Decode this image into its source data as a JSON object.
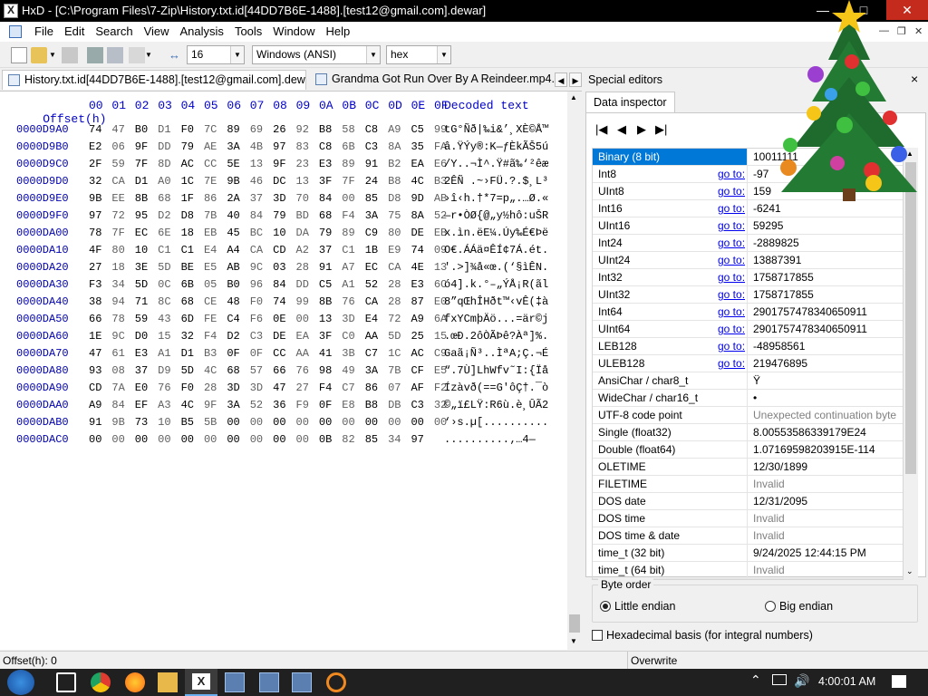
{
  "window": {
    "title": "HxD - [C:\\Program Files\\7-Zip\\History.txt.id[44DD7B6E-1488].[test12@gmail.com].dewar]"
  },
  "menu": [
    "File",
    "Edit",
    "Search",
    "View",
    "Analysis",
    "Tools",
    "Window",
    "Help"
  ],
  "toolbar": {
    "bytes_per_row": "16",
    "charset": "Windows (ANSI)",
    "offset_base": "hex"
  },
  "tabs": [
    {
      "label": "History.txt.id[44DD7B6E-1488].[test12@gmail.com].dewar"
    },
    {
      "label": "Grandma Got Run Over By A Reindeer.mp4.id["
    }
  ],
  "hex": {
    "offset_header": "Offset(h)",
    "column_headers": [
      "00",
      "01",
      "02",
      "03",
      "04",
      "05",
      "06",
      "07",
      "08",
      "09",
      "0A",
      "0B",
      "0C",
      "0D",
      "0E",
      "0F"
    ],
    "decoded_header": "Decoded text",
    "rows": [
      {
        "offset": "0000D9A0",
        "bytes": [
          "74",
          "47",
          "B0",
          "D1",
          "F0",
          "7C",
          "89",
          "69",
          "26",
          "92",
          "B8",
          "58",
          "C8",
          "A9",
          "C5",
          "99"
        ],
        "text": "tG°Ñð|‰i&’¸XÈ©Å™"
      },
      {
        "offset": "0000D9B0",
        "bytes": [
          "E2",
          "06",
          "9F",
          "DD",
          "79",
          "AE",
          "3A",
          "4B",
          "97",
          "83",
          "C8",
          "6B",
          "C3",
          "8A",
          "35",
          "FA"
        ],
        "text": "â.ŸÝy®:K—ƒÈkÃŠ5ú"
      },
      {
        "offset": "0000D9C0",
        "bytes": [
          "2F",
          "59",
          "7F",
          "8D",
          "AC",
          "CC",
          "5E",
          "13",
          "9F",
          "23",
          "E3",
          "89",
          "91",
          "B2",
          "EA",
          "E6"
        ],
        "text": "/Y..¬Ì^.Ÿ#ã‰‘²êæ"
      },
      {
        "offset": "0000D9D0",
        "bytes": [
          "32",
          "CA",
          "D1",
          "A0",
          "1C",
          "7E",
          "9B",
          "46",
          "DC",
          "13",
          "3F",
          "7F",
          "24",
          "B8",
          "4C",
          "B3"
        ],
        "text": "2ÊÑ .~›FÜ.?.$¸L³"
      },
      {
        "offset": "0000D9E0",
        "bytes": [
          "9B",
          "EE",
          "8B",
          "68",
          "1F",
          "86",
          "2A",
          "37",
          "3D",
          "70",
          "84",
          "00",
          "85",
          "D8",
          "9D",
          "AB"
        ],
        "text": "›î‹h.†*7=p„.…Ø.«"
      },
      {
        "offset": "0000D9F0",
        "bytes": [
          "97",
          "72",
          "95",
          "D2",
          "D8",
          "7B",
          "40",
          "84",
          "79",
          "BD",
          "68",
          "F4",
          "3A",
          "75",
          "8A",
          "52"
        ],
        "text": "—r•ÒØ{@„y½hô:uŠR"
      },
      {
        "offset": "0000DA00",
        "bytes": [
          "78",
          "7F",
          "EC",
          "6E",
          "18",
          "EB",
          "45",
          "BC",
          "10",
          "DA",
          "79",
          "89",
          "C9",
          "80",
          "DE",
          "EB"
        ],
        "text": "x.ìn.ëE¼.Úy‰É€Þë"
      },
      {
        "offset": "0000DA10",
        "bytes": [
          "4F",
          "80",
          "10",
          "C1",
          "C1",
          "E4",
          "A4",
          "CA",
          "CD",
          "A2",
          "37",
          "C1",
          "1B",
          "E9",
          "74",
          "09"
        ],
        "text": "O€.ÁÁä¤ÊÍ¢7Á.ét."
      },
      {
        "offset": "0000DA20",
        "bytes": [
          "27",
          "18",
          "3E",
          "5D",
          "BE",
          "E5",
          "AB",
          "9C",
          "03",
          "28",
          "91",
          "A7",
          "EC",
          "CA",
          "4E",
          "13"
        ],
        "text": "'.>]¾å«œ.(‘§ìÊN."
      },
      {
        "offset": "0000DA30",
        "bytes": [
          "F3",
          "34",
          "5D",
          "0C",
          "6B",
          "05",
          "B0",
          "96",
          "84",
          "DD",
          "C5",
          "A1",
          "52",
          "28",
          "E3",
          "6C"
        ],
        "text": "ó4].k.°–„ÝÅ¡R(ãl"
      },
      {
        "offset": "0000DA40",
        "bytes": [
          "38",
          "94",
          "71",
          "8C",
          "68",
          "CE",
          "48",
          "F0",
          "74",
          "99",
          "8B",
          "76",
          "CA",
          "28",
          "87",
          "E0"
        ],
        "text": "8”qŒhÎHðt™‹vÊ(‡à"
      },
      {
        "offset": "0000DA50",
        "bytes": [
          "66",
          "78",
          "59",
          "43",
          "6D",
          "FE",
          "C4",
          "F6",
          "0E",
          "00",
          "13",
          "3D",
          "E4",
          "72",
          "A9",
          "6A"
        ],
        "text": "fxYCmþÄö...=är©j"
      },
      {
        "offset": "0000DA60",
        "bytes": [
          "1E",
          "9C",
          "D0",
          "15",
          "32",
          "F4",
          "D2",
          "C3",
          "DE",
          "EA",
          "3F",
          "C0",
          "AA",
          "5D",
          "25",
          "15"
        ],
        "text": ".œÐ.2ôÒÃÞê?Àª]%."
      },
      {
        "offset": "0000DA70",
        "bytes": [
          "47",
          "61",
          "E3",
          "A1",
          "D1",
          "B3",
          "0F",
          "0F",
          "CC",
          "AA",
          "41",
          "3B",
          "C7",
          "1C",
          "AC",
          "C9"
        ],
        "text": "Gaã¡Ñ³..ÌªA;Ç.¬É"
      },
      {
        "offset": "0000DA80",
        "bytes": [
          "93",
          "08",
          "37",
          "D9",
          "5D",
          "4C",
          "68",
          "57",
          "66",
          "76",
          "98",
          "49",
          "3A",
          "7B",
          "CF",
          "E5"
        ],
        "text": "“.7Ù]LhWfv˜I:{Ïå"
      },
      {
        "offset": "0000DA90",
        "bytes": [
          "CD",
          "7A",
          "E0",
          "76",
          "F0",
          "28",
          "3D",
          "3D",
          "47",
          "27",
          "F4",
          "C7",
          "86",
          "07",
          "AF",
          "F2"
        ],
        "text": "Ízàvð(==G'ôÇ†.¯ò"
      },
      {
        "offset": "0000DAA0",
        "bytes": [
          "A9",
          "84",
          "EF",
          "A3",
          "4C",
          "9F",
          "3A",
          "52",
          "36",
          "F9",
          "0F",
          "E8",
          "B8",
          "DB",
          "C3",
          "32"
        ],
        "text": "©„ï£LŸ:R6ù.è¸ÛÃ2"
      },
      {
        "offset": "0000DAB0",
        "bytes": [
          "91",
          "9B",
          "73",
          "10",
          "B5",
          "5B",
          "00",
          "00",
          "00",
          "00",
          "00",
          "00",
          "00",
          "00",
          "00",
          "00"
        ],
        "text": "‘›s.µ[.........."
      },
      {
        "offset": "0000DAC0",
        "bytes": [
          "00",
          "00",
          "00",
          "00",
          "00",
          "00",
          "00",
          "00",
          "00",
          "00",
          "0B",
          "82",
          "85",
          "34",
          "97"
        ],
        "text": "..........‚…4—"
      }
    ]
  },
  "special_editors": {
    "title": "Special editors",
    "close": "×"
  },
  "data_inspector": {
    "tab": "Data inspector",
    "goto_label": "go to:",
    "rows": [
      {
        "label": "Binary (8 bit)",
        "value": "10011111",
        "goto": false,
        "selected": true
      },
      {
        "label": "Int8",
        "value": "-97",
        "goto": true
      },
      {
        "label": "UInt8",
        "value": "159",
        "goto": true
      },
      {
        "label": "Int16",
        "value": "-6241",
        "goto": true
      },
      {
        "label": "UInt16",
        "value": "59295",
        "goto": true
      },
      {
        "label": "Int24",
        "value": "-2889825",
        "goto": true
      },
      {
        "label": "UInt24",
        "value": "13887391",
        "goto": true
      },
      {
        "label": "Int32",
        "value": "1758717855",
        "goto": true
      },
      {
        "label": "UInt32",
        "value": "1758717855",
        "goto": true
      },
      {
        "label": "Int64",
        "value": "2901757478340650911",
        "goto": true
      },
      {
        "label": "UInt64",
        "value": "2901757478340650911",
        "goto": true
      },
      {
        "label": "LEB128",
        "value": "-48958561",
        "goto": true
      },
      {
        "label": "ULEB128",
        "value": "219476895",
        "goto": true
      },
      {
        "label": "AnsiChar / char8_t",
        "value": "Ÿ",
        "goto": false
      },
      {
        "label": "WideChar / char16_t",
        "value": "•",
        "goto": false
      },
      {
        "label": "UTF-8 code point",
        "value": "Unexpected continuation byte",
        "goto": false,
        "gray": true
      },
      {
        "label": "Single (float32)",
        "value": "8.00553586339179E24",
        "goto": false
      },
      {
        "label": "Double (float64)",
        "value": "1.07169598203915E-114",
        "goto": false
      },
      {
        "label": "OLETIME",
        "value": "12/30/1899",
        "goto": false
      },
      {
        "label": "FILETIME",
        "value": "Invalid",
        "goto": false,
        "gray": true
      },
      {
        "label": "DOS date",
        "value": "12/31/2095",
        "goto": false
      },
      {
        "label": "DOS time",
        "value": "Invalid",
        "goto": false,
        "gray": true
      },
      {
        "label": "DOS time & date",
        "value": "Invalid",
        "goto": false,
        "gray": true
      },
      {
        "label": "time_t (32 bit)",
        "value": "9/24/2025 12:44:15 PM",
        "goto": false
      },
      {
        "label": "time_t (64 bit)",
        "value": "Invalid",
        "goto": false,
        "gray": true
      }
    ],
    "byte_order": {
      "legend": "Byte order",
      "little": "Little endian",
      "big": "Big endian",
      "selected": "little"
    },
    "hex_basis": "Hexadecimal basis (for integral numbers)"
  },
  "status": {
    "offset": "Offset(h): 0",
    "mode": "Overwrite"
  },
  "taskbar": {
    "time": "4:00:01 AM"
  },
  "colors": {
    "selection": "#0078d7",
    "offset_blue": "#0000b0",
    "link": "#0000ee"
  }
}
